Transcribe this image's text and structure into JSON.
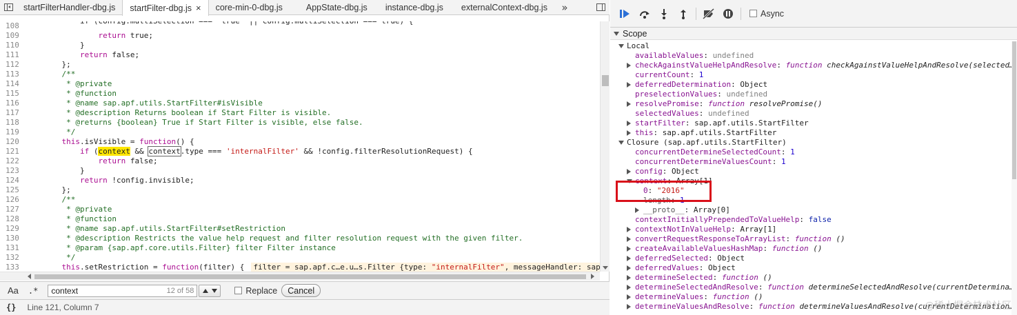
{
  "tabs": [
    {
      "label": "startFilterHandler-dbg.js",
      "active": false
    },
    {
      "label": "startFilter-dbg.js",
      "active": true
    },
    {
      "label": "core-min-0-dbg.js",
      "active": false
    },
    {
      "label": "AppState-dbg.js",
      "active": false
    },
    {
      "label": "instance-dbg.js",
      "active": false
    },
    {
      "label": "externalContext-dbg.js",
      "active": false
    }
  ],
  "tab_close_glyph": "×",
  "tab_more_glyph": "»",
  "code_lines": [
    {
      "n": "108",
      "html": "<span style='position:relative;top:-7px'>        if (config.multiSelection === 'true' || config.multiSelection === true) {</span>"
    },
    {
      "n": "109",
      "html": "            <span class='c-kw'>return</span> true;"
    },
    {
      "n": "110",
      "html": "        }"
    },
    {
      "n": "111",
      "html": "        <span class='c-kw'>return</span> false;"
    },
    {
      "n": "112",
      "html": "    };"
    },
    {
      "n": "113",
      "html": "    <span class='c-com'>/**</span>"
    },
    {
      "n": "114",
      "html": "<span class='c-com'>     * @private</span>"
    },
    {
      "n": "115",
      "html": "<span class='c-com'>     * @function</span>"
    },
    {
      "n": "116",
      "html": "<span class='c-com'>     * @name sap.apf.utils.StartFilter#isVisible</span>"
    },
    {
      "n": "117",
      "html": "<span class='c-com'>     * @description Returns boolean if Start Filter is visible.</span>"
    },
    {
      "n": "118",
      "html": "<span class='c-com'>     * @returns {boolean} True if Start Filter is visible, else false.</span>"
    },
    {
      "n": "119",
      "html": "<span class='c-com'>     */</span>"
    },
    {
      "n": "120",
      "html": "    <span class='c-kw'>this</span>.isVisible = <span class='c-kw'>function</span>() {"
    },
    {
      "n": "121",
      "html": "        <span class='c-kw'>if</span> (<span class='hl'>context</span> &amp;&amp; <span class='box-hl'>context</span>.type === <span class='c-str'>'internalFilter'</span> &amp;&amp; !config.filterResolutionRequest) {"
    },
    {
      "n": "122",
      "html": "            <span class='c-kw'>return</span> false;"
    },
    {
      "n": "123",
      "html": "        }"
    },
    {
      "n": "124",
      "html": "        <span class='c-kw'>return</span> !config.invisible;"
    },
    {
      "n": "125",
      "html": "    };"
    },
    {
      "n": "126",
      "html": "    <span class='c-com'>/**</span>"
    },
    {
      "n": "127",
      "html": "<span class='c-com'>     * @private</span>"
    },
    {
      "n": "128",
      "html": "<span class='c-com'>     * @function</span>"
    },
    {
      "n": "129",
      "html": "<span class='c-com'>     * @name sap.apf.utils.StartFilter#setRestriction</span>"
    },
    {
      "n": "130",
      "html": "<span class='c-com'>     * @description Restricts the value help request and filter resolution request with the given filter.</span>"
    },
    {
      "n": "131",
      "html": "<span class='c-com'>     * @param {sap.apf.core.utils.Filter} filter Filter instance</span>"
    },
    {
      "n": "132",
      "html": "<span class='c-com'>     */</span>"
    },
    {
      "n": "133",
      "html": "    <span class='c-kw'>this</span>.setRestriction = <span class='c-kw'>function</span>(filter) {<span class='inline-val'>filter = sap.apf.c…e.u…s.Filter {type: <span class='c-str'>\"internalFilter\"</span>, messageHandler: sap.apf</span>"
    }
  ],
  "search": {
    "aa_label": "Aa",
    "regex_label": ".*",
    "value": "context",
    "count": "12 of 58",
    "replace_label": "Replace",
    "cancel_label": "Cancel"
  },
  "status": {
    "pretty_print_label": "{}",
    "position": "Line 121, Column 7"
  },
  "debugger": {
    "async_label": "Async"
  },
  "scope": {
    "header": "Scope",
    "rows": [
      {
        "indent": 0,
        "tri": "down",
        "html": "Local"
      },
      {
        "indent": 1,
        "tri": "",
        "html": "<span class='k'>availableValues</span>: <span class='v-undef'>undefined</span>"
      },
      {
        "indent": 1,
        "tri": "right",
        "html": "<span class='k'>checkAgainstValueHelpAndResolve</span>: <span class='v-fn'>function</span> <span class='v-fnbody'>checkAgainstValueHelpAndResolve(selected…</span>"
      },
      {
        "indent": 1,
        "tri": "",
        "html": "<span class='k'>currentCount</span>: <span class='v-num'>1</span>"
      },
      {
        "indent": 1,
        "tri": "right",
        "html": "<span class='k'>deferredDetermination</span>: <span class='v-obj'>Object</span>"
      },
      {
        "indent": 1,
        "tri": "",
        "html": "<span class='k'>preselectionValues</span>: <span class='v-undef'>undefined</span>"
      },
      {
        "indent": 1,
        "tri": "right",
        "html": "<span class='k'>resolvePromise</span>: <span class='v-fn'>function</span> <span class='v-fnbody'>resolvePromise()</span>"
      },
      {
        "indent": 1,
        "tri": "",
        "html": "<span class='k'>selectedValues</span>: <span class='v-undef'>undefined</span>"
      },
      {
        "indent": 1,
        "tri": "right",
        "html": "<span class='k'>startFilter</span>: <span class='v-obj'>sap.apf.utils.StartFilter</span>"
      },
      {
        "indent": 1,
        "tri": "right",
        "html": "<span class='k'>this</span>: <span class='v-obj'>sap.apf.utils.StartFilter</span>"
      },
      {
        "indent": 0,
        "tri": "down",
        "html": "Closure (sap.apf.utils.StartFilter)"
      },
      {
        "indent": 1,
        "tri": "",
        "html": "<span class='k'>concurrentDetermineSelectedCount</span>: <span class='v-num'>1</span>"
      },
      {
        "indent": 1,
        "tri": "",
        "html": "<span class='k'>concurrentDetermineValuesCount</span>: <span class='v-num'>1</span>"
      },
      {
        "indent": 1,
        "tri": "right",
        "html": "<span class='k'>config</span>: <span class='v-obj'>Object</span>"
      },
      {
        "indent": 1,
        "tri": "down",
        "html": "<span class='k'>context</span>: <span class='v-obj'>Array[1]</span>"
      },
      {
        "indent": 2,
        "tri": "",
        "html": "<span class='k'>0</span>: <span class='v-str'>\"2016\"</span>"
      },
      {
        "indent": 2,
        "tri": "",
        "html": "<span class='ku'>length</span>: <span class='v-num'>1</span>"
      },
      {
        "indent": 2,
        "tri": "right",
        "html": "<span class='ku'>__proto__</span>: <span class='v-obj'>Array[0]</span>"
      },
      {
        "indent": 1,
        "tri": "",
        "html": "<span class='k'>contextInitiallyPrependedToValueHelp</span>: <span class='v-bool'>false</span>"
      },
      {
        "indent": 1,
        "tri": "right",
        "html": "<span class='k'>contextNotInValueHelp</span>: <span class='v-obj'>Array[1]</span>"
      },
      {
        "indent": 1,
        "tri": "right",
        "html": "<span class='k'>convertRequestResponseToArrayList</span>: <span class='v-fn'>function</span> <span class='v-fnbody'>()</span>"
      },
      {
        "indent": 1,
        "tri": "right",
        "html": "<span class='k'>createAvailableValuesHashMap</span>: <span class='v-fn'>function</span> <span class='v-fnbody'>()</span>"
      },
      {
        "indent": 1,
        "tri": "right",
        "html": "<span class='k'>deferredSelected</span>: <span class='v-obj'>Object</span>"
      },
      {
        "indent": 1,
        "tri": "right",
        "html": "<span class='k'>deferredValues</span>: <span class='v-obj'>Object</span>"
      },
      {
        "indent": 1,
        "tri": "right",
        "html": "<span class='k'>determineSelected</span>: <span class='v-fn'>function</span> <span class='v-fnbody'>()</span>"
      },
      {
        "indent": 1,
        "tri": "right",
        "html": "<span class='k'>determineSelectedAndResolve</span>: <span class='v-fn'>function</span> <span class='v-fnbody'>determineSelectedAndResolve(currentDetermina…</span>"
      },
      {
        "indent": 1,
        "tri": "right",
        "html": "<span class='k'>determineValues</span>: <span class='v-fn'>function</span> <span class='v-fnbody'>()</span>"
      },
      {
        "indent": 1,
        "tri": "right",
        "html": "<span class='k'>determineValuesAndResolve</span>: <span class='v-fn'>function</span> <span class='v-fnbody'>determineValuesAndResolve(currentDetermination…</span>"
      }
    ]
  },
  "watermark": "@稀土掘金技术社区"
}
